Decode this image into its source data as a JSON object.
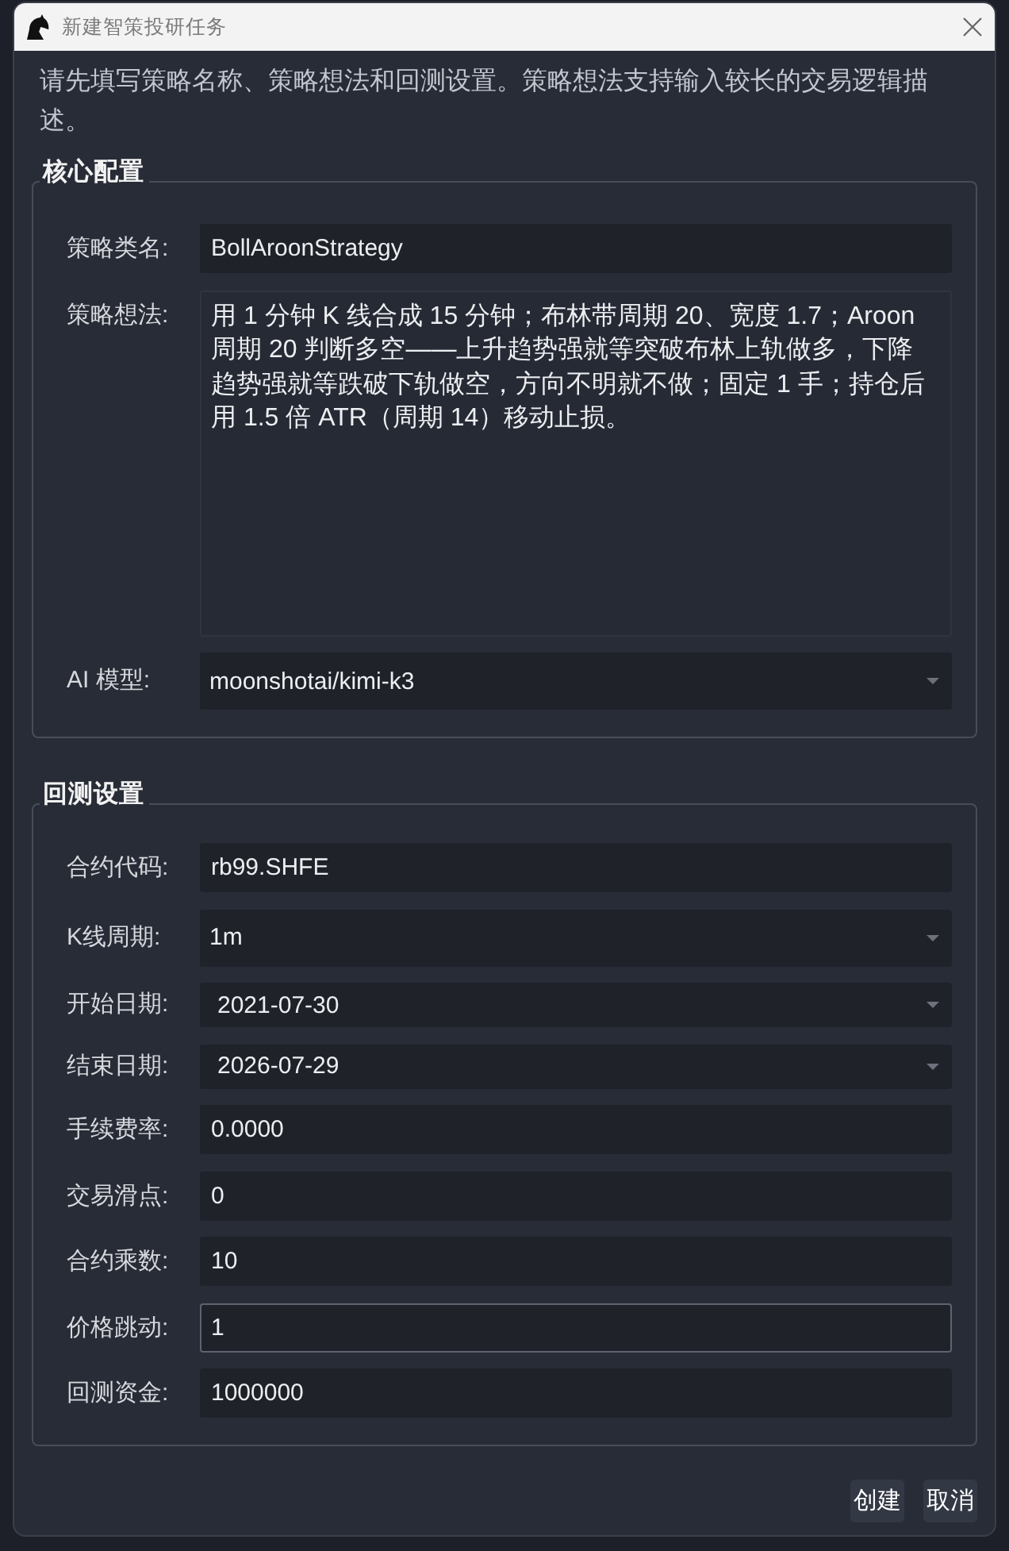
{
  "window": {
    "title": "新建智策投研任务"
  },
  "description": "请先填写策略名称、策略想法和回测设置。策略想法支持输入较长的交易逻辑描述。",
  "groups": [
    {
      "title": "核心配置",
      "fields": [
        {
          "label": "策略类名:",
          "kind": "text",
          "value": "BollAroonStrategy",
          "focused": false
        },
        {
          "label": "策略想法:",
          "kind": "textarea",
          "value": "用 1 分钟 K 线合成 15 分钟；布林带周期 20、宽度 1.7；Aroon 周期 20 判断多空——上升趋势强就等突破布林上轨做多，下降趋势强就等跌破下轨做空，方向不明就不做；固定 1 手；持仓后用 1.5 倍 ATR（周期 14）移动止损。",
          "focused": false
        },
        {
          "label": "AI 模型:",
          "kind": "combo",
          "value": "moonshotai/kimi-k3",
          "focused": false
        }
      ]
    },
    {
      "title": "回测设置",
      "fields": [
        {
          "label": "合约代码:",
          "kind": "text",
          "value": "rb99.SHFE",
          "focused": false
        },
        {
          "label": "K线周期:",
          "kind": "combo",
          "value": "1m",
          "focused": false
        },
        {
          "label": "开始日期:",
          "kind": "date",
          "value": "2021-07-30",
          "focused": false
        },
        {
          "label": "结束日期:",
          "kind": "date",
          "value": "2026-07-29",
          "focused": false
        },
        {
          "label": "手续费率:",
          "kind": "text",
          "value": "0.0000",
          "focused": false
        },
        {
          "label": "交易滑点:",
          "kind": "text",
          "value": "0",
          "focused": false
        },
        {
          "label": "合约乘数:",
          "kind": "text",
          "value": "10",
          "focused": false
        },
        {
          "label": "价格跳动:",
          "kind": "text",
          "value": "1",
          "focused": true
        },
        {
          "label": "回测资金:",
          "kind": "text",
          "value": "1000000",
          "focused": false
        }
      ]
    }
  ],
  "buttons": [
    {
      "label": "创建"
    },
    {
      "label": "取消"
    }
  ]
}
